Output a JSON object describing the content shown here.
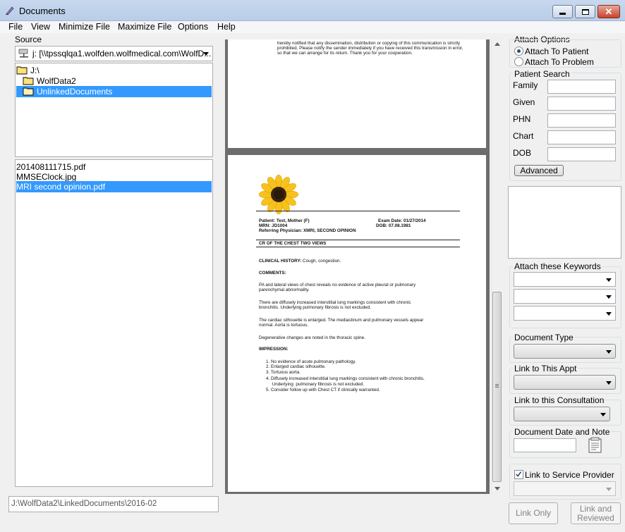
{
  "window": {
    "title": "Documents"
  },
  "menu": [
    "File",
    "View",
    "Minimize File",
    "Maximize File",
    "Options",
    "Help"
  ],
  "source": {
    "label": "Source",
    "drive": "j: [\\\\tpssqlqa1.wolfden.wolfmedical.com\\WolfD...",
    "tree": [
      "J:\\",
      "WolfData2",
      "UnlinkedDocuments"
    ],
    "files": [
      "201408111715.pdf",
      "MMSEClock.jpg",
      "MRI second opinion.pdf"
    ],
    "path": "J:\\WolfData2\\LinkedDocuments\\2016-02"
  },
  "document": {
    "disclaimer": [
      "hereby notified that any dissemination, distribution or copying of this communication is strictly",
      "prohibited. Please notify the sender immediately if you have received this transmission in error,",
      "so that we can arrange for its return. Thank you for your cooperation."
    ],
    "patient": "Patient: Test, Mother (F)",
    "exam_date": "Exam Date: 01/27/2014",
    "mrn": "MRN: JD1004",
    "dob": "DOB: 07.08.1981",
    "referring": "Referring Physician: XMRI, SECOND OPINION",
    "exam_title": "CR OF THE CHEST TWO VIEWS",
    "history_label": "CLINICAL HISTORY:",
    "history_text": "Cough, congestion.",
    "comments_label": "COMMENTS:",
    "para1": [
      "PA and lateral views of chest reveals no evidence of active pleural or pulmonary",
      "parenchymal abnormality."
    ],
    "para2": [
      "There are diffusely increased interstitial lung markings consistent with chronic",
      "bronchitis. Underlying pulmonary fibrosis is not excluded."
    ],
    "para3": [
      "The cardiac silhouette is enlarged. The mediastinum and pulmonary vessels appear",
      "normal. Aorta is tortuous."
    ],
    "para4": "Degenerative changes are noted in the thoracic spine.",
    "impression_label": "IMPRESSION:",
    "impressions": [
      "1.  No evidence of acute pulmonary pathology.",
      "2.  Enlarged cardiac silhouette.",
      "3.  Tortuous aorta.",
      "4.  Diffusely increased interstitial lung markings consistent with chronic bronchitis.",
      "     Underlying  pulmonary fibrosis is not excluded.",
      "5.  Consider follow up with Chest CT if clinically warranted."
    ]
  },
  "attach": {
    "label": "Attach Options",
    "options": [
      "Attach To Patient",
      "Attach To Problem"
    ],
    "selected": "Attach To Patient"
  },
  "patient_search": {
    "label": "Patient Search",
    "fields": [
      "Family",
      "Given",
      "PHN",
      "Chart",
      "DOB"
    ],
    "advanced": "Advanced"
  },
  "keywords": {
    "label": "Attach these Keywords"
  },
  "document_type": {
    "label": "Document Type"
  },
  "appt": {
    "label": "Link to This Appt"
  },
  "consultation": {
    "label": "Link to this Consultation"
  },
  "date_note": {
    "label": "Document Date and Note"
  },
  "service_provider": {
    "label": "Link to Service Provider",
    "checked": true
  },
  "buttons": {
    "link_only": "Link Only",
    "link_reviewed_1": "Link and",
    "link_reviewed_2": "Reviewed"
  },
  "colors": {
    "selection": "#3399ff",
    "titlebar": "#c7d8ee",
    "viewer_bg": "#6d6d6d"
  }
}
